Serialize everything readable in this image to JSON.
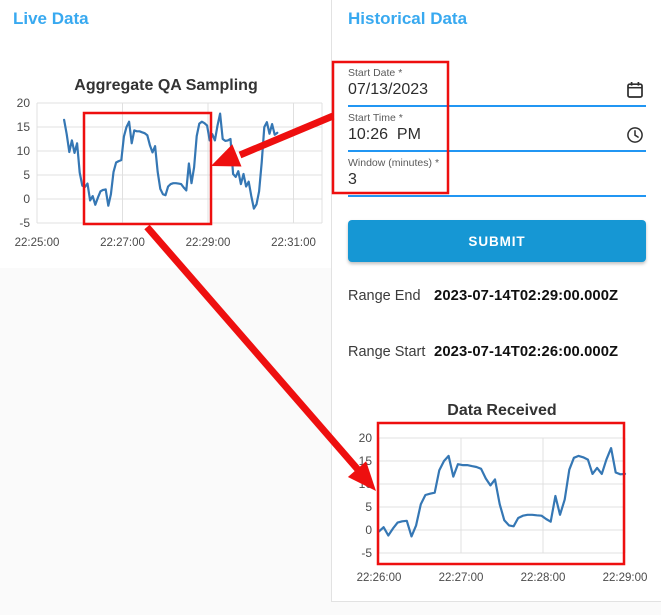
{
  "colors": {
    "accent_blue": "#38a9f0",
    "button_blue": "#1697d4",
    "underline_blue": "#2196f3",
    "line_blue": "#3577b4",
    "grid_gray": "#e0e0e0",
    "tick_label": "#4a4a4a",
    "chart_title": "#333333",
    "annotation_red": "#ee0f0f"
  },
  "live_panel": {
    "title": "Live Data"
  },
  "historical_panel": {
    "title": "Historical Data",
    "fields": [
      {
        "name": "start-date",
        "label": "Start Date",
        "required_marker": "*",
        "value": "07/13/2023",
        "icon": "calendar-icon"
      },
      {
        "name": "start-time",
        "label": "Start Time",
        "required_marker": "*",
        "value": "10:26  PM",
        "icon": "clock-icon"
      },
      {
        "name": "window-minutes",
        "label": "Window (minutes)",
        "required_marker": "*",
        "value": "3",
        "icon": null
      }
    ],
    "submit_label": "SUBMIT",
    "results": [
      {
        "name": "range-end",
        "label": "Range End",
        "value": "2023-07-14T02:29:00.000Z"
      },
      {
        "name": "range-start",
        "label": "Range Start",
        "value": "2023-07-14T02:26:00.000Z"
      }
    ]
  },
  "chart_data": [
    {
      "type": "line",
      "title": "Aggregate QA Sampling",
      "x_tick_labels": [
        "22:25:00",
        "22:27:00",
        "22:29:00",
        "22:31:00"
      ],
      "x_tick_seconds": [
        0,
        120,
        240,
        360
      ],
      "x_domain_seconds": [
        0,
        400
      ],
      "y_ticks": [
        20,
        15,
        10,
        5,
        0,
        -5
      ],
      "ylim": [
        -5,
        20
      ],
      "grid": true,
      "legend": false,
      "series": [
        {
          "name": "aggregate-qa-sampling",
          "start_second": 38,
          "interval_seconds": 3.65,
          "values": [
            16.5,
            13.5,
            9.8,
            12.2,
            9.6,
            11.6,
            5.5,
            2.8,
            2.5,
            3.2,
            -0.3,
            0.6,
            -1.2,
            0.3,
            1.6,
            1.9,
            2,
            -1.4,
            1,
            5.6,
            7.6,
            7.9,
            8.1,
            13,
            15,
            16.1,
            11.6,
            14.3,
            14.1,
            14.1,
            13.9,
            13.7,
            13.3,
            11.2,
            9.7,
            11,
            5.6,
            2.1,
            1,
            0.8,
            2.6,
            3.1,
            3.3,
            3.3,
            3.2,
            3.1,
            2.4,
            1.8,
            7.4,
            3.3,
            6.6,
            13.1,
            15.7,
            16.1,
            15.8,
            15.3,
            12.2,
            13.5,
            12.2,
            15.3,
            17.8,
            12.5,
            12.1,
            12.2,
            12.5,
            5.2,
            4.6,
            5.8,
            3.1,
            5.2,
            2.6,
            3.6,
            0.6,
            -2,
            -1.1,
            1.6,
            7.6,
            15,
            16,
            13.6,
            15.6,
            13.4,
            13.8
          ]
        }
      ]
    },
    {
      "type": "line",
      "title": "Data Received",
      "x_tick_labels": [
        "22:26:00",
        "22:27:00",
        "22:28:00",
        "22:29:00"
      ],
      "x_tick_seconds": [
        0,
        60,
        120,
        180
      ],
      "x_domain_seconds": [
        0,
        180
      ],
      "y_ticks": [
        20,
        15,
        10,
        5,
        0,
        -5
      ],
      "ylim": [
        -5,
        20
      ],
      "grid": true,
      "legend": false,
      "series": [
        {
          "name": "data-received",
          "start_second": 0,
          "interval_seconds": 3.3962,
          "values": [
            -0.3,
            0.6,
            -1.2,
            0.3,
            1.6,
            1.9,
            2,
            -1.4,
            1,
            5.6,
            7.6,
            7.9,
            8.1,
            13,
            15,
            16.1,
            11.6,
            14.3,
            14.1,
            14.1,
            13.9,
            13.7,
            13.3,
            11.2,
            9.7,
            11,
            5.6,
            2.1,
            1,
            0.8,
            2.6,
            3.1,
            3.3,
            3.3,
            3.2,
            3.1,
            2.4,
            1.8,
            7.4,
            3.3,
            6.6,
            13.1,
            15.7,
            16.1,
            15.8,
            15.3,
            12.2,
            13.5,
            12.2,
            15.3,
            17.8,
            12.5,
            12.1,
            12.2
          ]
        }
      ]
    }
  ]
}
